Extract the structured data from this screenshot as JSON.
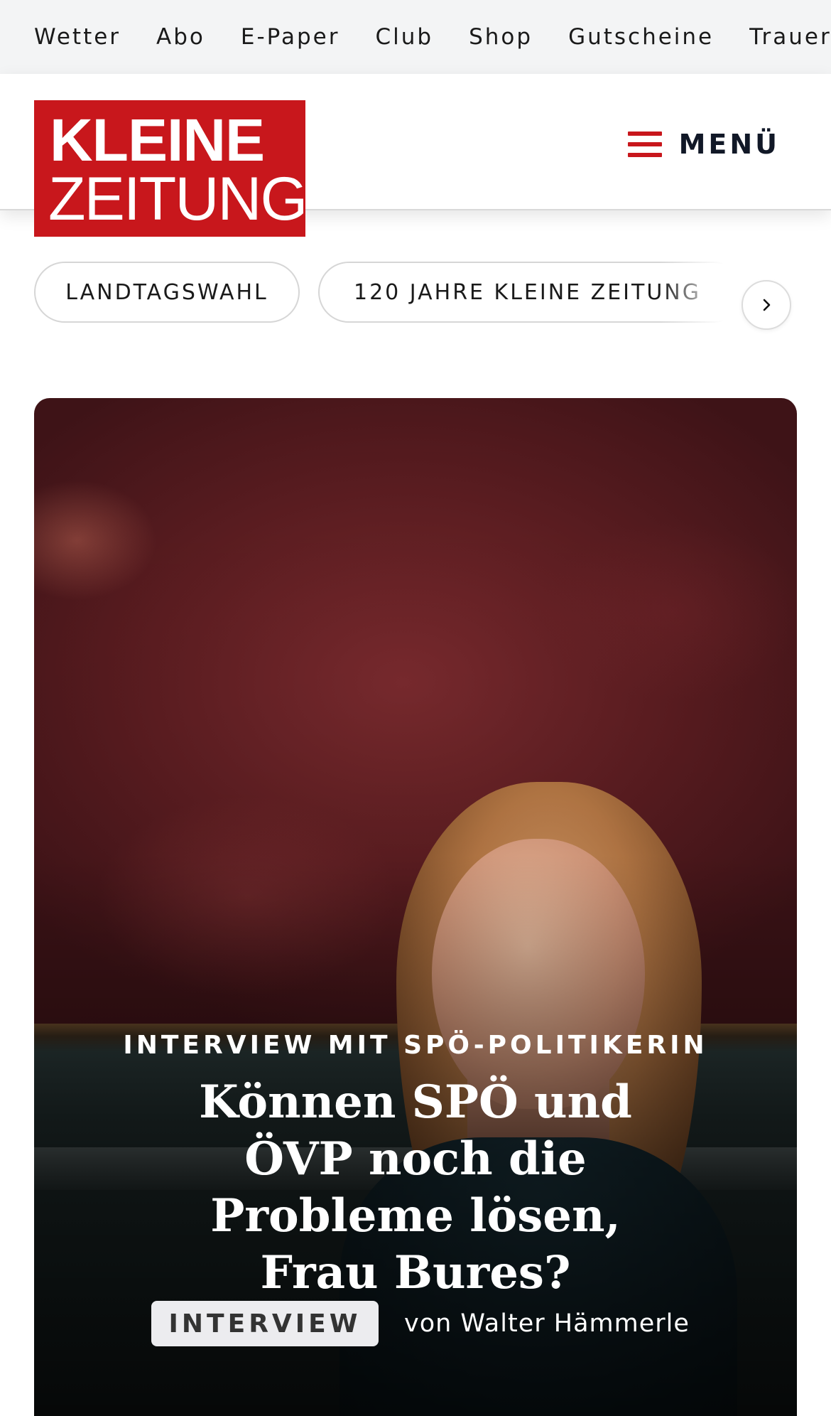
{
  "topnav": {
    "items": [
      "Wetter",
      "Abo",
      "E-Paper",
      "Club",
      "Shop",
      "Gutscheine",
      "Trauerp"
    ]
  },
  "header": {
    "logo_line1": "KLEINE",
    "logo_line2": "ZEITUNG",
    "menu_label": "MENÜ"
  },
  "topics": {
    "chips": [
      "LANDTAGSWAHL",
      "120 JAHRE KLEINE ZEITUNG"
    ]
  },
  "hero": {
    "kicker": "INTERVIEW MIT SPÖ-POLITIKERIN",
    "headline": "Können SPÖ und ÖVP noch die Probleme lösen, Frau Bures?",
    "badge": "INTERVIEW",
    "author": "von Walter Hämmerle"
  },
  "colors": {
    "brand_red": "#c8171c",
    "topnav_bg": "#f3f4f5"
  }
}
